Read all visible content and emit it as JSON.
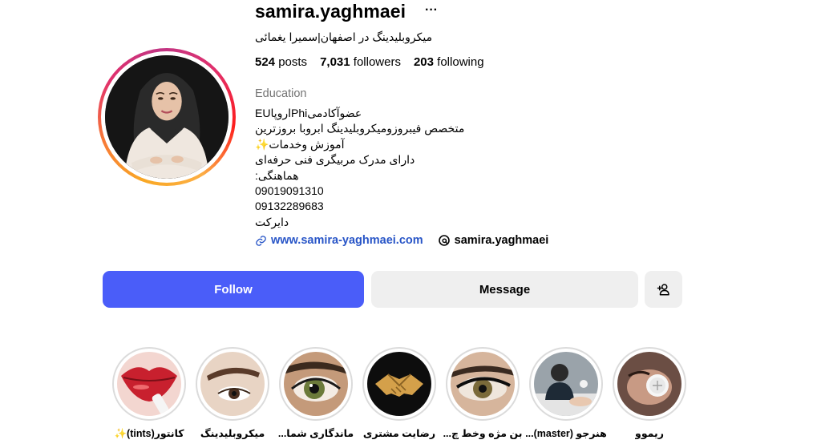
{
  "profile": {
    "username": "samira.yaghmaei",
    "more_label": "···",
    "full_name": "میکروبلیدینگ در اصفهان|سمیرا یغمائی",
    "stats": {
      "posts_count": "524",
      "posts_label": "posts",
      "followers_count": "7,031",
      "followers_label": "followers",
      "following_count": "203",
      "following_label": "following"
    },
    "category": "Education",
    "bio": [
      "عضوآکادمیPhiاروپاEU",
      "متخصص فیبروزومیکروبلیدینگ ابروبا بروزترین",
      "آموزش وخدمات✨",
      "دارای مدرک مربیگری فنی حرفه‌ای",
      "هماهنگی:",
      "09019091310",
      "09132289683",
      "دایرکت"
    ],
    "website": "www.samira-yaghmaei.com",
    "threads_handle": "samira.yaghmaei"
  },
  "actions": {
    "follow_label": "Follow",
    "message_label": "Message"
  },
  "highlights": [
    {
      "label": "کانتور(tints)✨",
      "icon": "lips-thumbnail"
    },
    {
      "label": "میکروبلیدینگ",
      "icon": "eyebrow-thumbnail"
    },
    {
      "label": "ماندگاری شما...",
      "icon": "eye-thumbnail"
    },
    {
      "label": "رضایت مشتری",
      "icon": "handshake-thumbnail"
    },
    {
      "label": "بن مژه وخط چ...",
      "icon": "eyeliner-thumbnail"
    },
    {
      "label": "هنرجو (master)...",
      "icon": "student-thumbnail"
    },
    {
      "label": "ریموو",
      "icon": "remove-thumbnail"
    }
  ],
  "colors": {
    "follow_button": "#4a5df9",
    "secondary_button": "#efefef",
    "link": "#2855c7",
    "muted_text": "#737373"
  }
}
